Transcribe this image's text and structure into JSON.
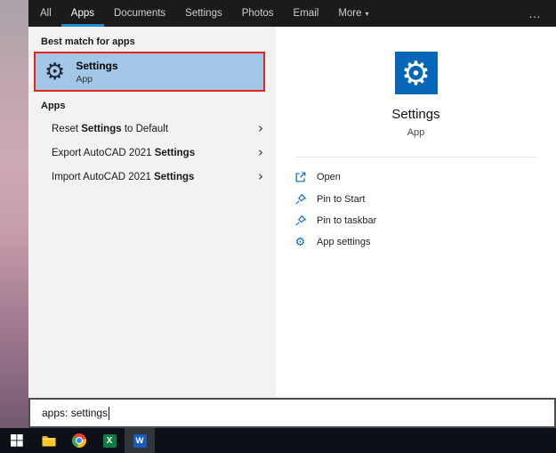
{
  "tabs": {
    "items": [
      "All",
      "Apps",
      "Documents",
      "Settings",
      "Photos",
      "Email",
      "More"
    ],
    "selected": "Apps",
    "more_caret": "▾",
    "overflow": "…"
  },
  "icons": {
    "gear": "⚙",
    "chevron_right": "›"
  },
  "left_panel": {
    "best_match_header": "Best match for apps",
    "best_match": {
      "title": "Settings",
      "subtitle": "App"
    },
    "apps_header": "Apps",
    "items": [
      {
        "pre": "Reset ",
        "bold": "Settings",
        "post": " to Default"
      },
      {
        "pre": "Export AutoCAD 2021 ",
        "bold": "Settings",
        "post": ""
      },
      {
        "pre": "Import AutoCAD 2021 ",
        "bold": "Settings",
        "post": ""
      }
    ]
  },
  "preview_panel": {
    "title": "Settings",
    "subtitle": "App",
    "actions": [
      {
        "label": "Open",
        "icon": "open-icon"
      },
      {
        "label": "Pin to Start",
        "icon": "pin-icon"
      },
      {
        "label": "Pin to taskbar",
        "icon": "pin-icon"
      },
      {
        "label": "App settings",
        "icon": "gear-icon"
      }
    ]
  },
  "search": {
    "value": "apps: settings"
  },
  "taskbar": {
    "items": [
      {
        "name": "start"
      },
      {
        "name": "file-explorer"
      },
      {
        "name": "chrome"
      },
      {
        "name": "excel",
        "letter": "X"
      },
      {
        "name": "word",
        "letter": "W"
      }
    ]
  },
  "colors": {
    "accent": "#0078d7",
    "selection": "#a3c7e6",
    "annotation_red": "#e3251e",
    "tile_blue": "#0667b8"
  }
}
